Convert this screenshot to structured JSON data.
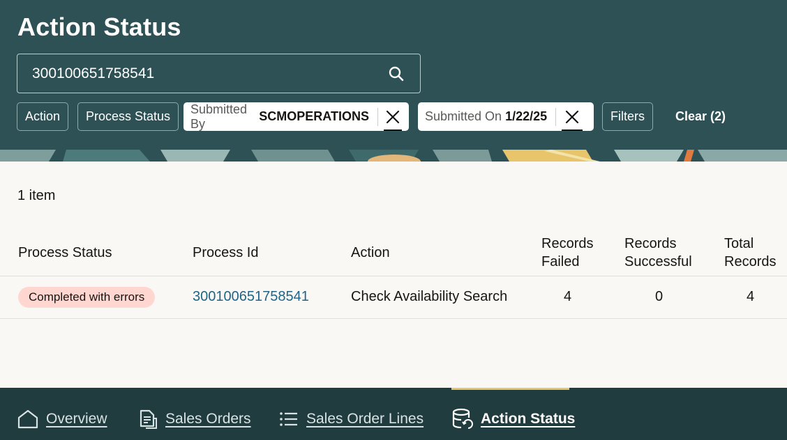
{
  "header": {
    "title": "Action Status",
    "search": {
      "value": "300100651758541",
      "icon": "search-icon"
    },
    "filters": {
      "action_label": "Action",
      "process_status_label": "Process Status",
      "submitted_by": {
        "label": "Submitted By",
        "value": "SCMOPERATIONS"
      },
      "submitted_on": {
        "label": "Submitted On",
        "value": "1/22/25"
      },
      "filters_label": "Filters",
      "clear_label": "Clear (2)"
    }
  },
  "results": {
    "count_text": "1 item",
    "columns": {
      "process_status": "Process Status",
      "process_id": "Process Id",
      "action": "Action",
      "records_failed_1": "Records",
      "records_failed_2": "Failed",
      "records_successful_1": "Records",
      "records_successful_2": "Successful",
      "total_records_1": "Total",
      "total_records_2": "Records"
    },
    "rows": [
      {
        "process_status": "Completed with errors",
        "process_id": "300100651758541",
        "action": "Check Availability Search",
        "records_failed": "4",
        "records_successful": "0",
        "total_records": "4"
      }
    ]
  },
  "nav": {
    "items": [
      {
        "label": "Overview",
        "icon": "home-icon"
      },
      {
        "label": "Sales Orders",
        "icon": "document-icon"
      },
      {
        "label": "Sales Order Lines",
        "icon": "list-icon"
      },
      {
        "label": "Action Status",
        "icon": "database-refresh-icon"
      }
    ],
    "active": "Action Status"
  },
  "colors": {
    "header_bg": "#2e5156",
    "nav_bg": "#203c3f",
    "link": "#1e6587",
    "error_badge": "#ffd7d0",
    "active_indicator": "#e8c56b"
  }
}
